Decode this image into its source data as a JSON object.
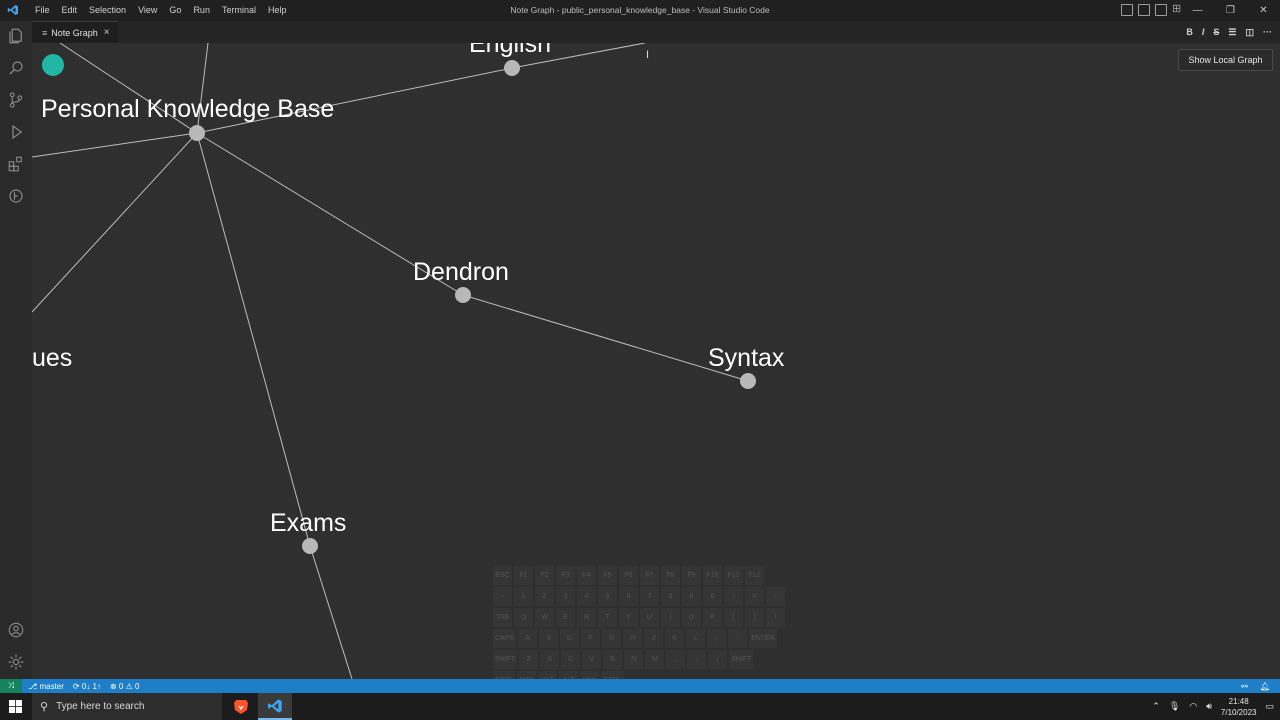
{
  "window": {
    "title": "Note Graph - public_personal_knowledge_base - Visual Studio Code",
    "menu": [
      "File",
      "Edit",
      "Selection",
      "View",
      "Go",
      "Run",
      "Terminal",
      "Help"
    ]
  },
  "tab": {
    "label": "Note Graph",
    "close": "×"
  },
  "editor_actions": [
    "B",
    "I",
    "S",
    "list-icon",
    "split-icon",
    "more-icon"
  ],
  "graph": {
    "show_local_button": "Show Local Graph",
    "nodes": [
      {
        "id": "english",
        "label": "English"
      },
      {
        "id": "pkb",
        "label": "Personal Knowledge Base"
      },
      {
        "id": "dendron",
        "label": "Dendron"
      },
      {
        "id": "syntax",
        "label": "Syntax"
      },
      {
        "id": "ues",
        "label": "ues"
      },
      {
        "id": "exams",
        "label": "Exams"
      }
    ],
    "edges": [
      [
        "pkb",
        "english"
      ],
      [
        "pkb",
        "dendron"
      ],
      [
        "dendron",
        "syntax"
      ],
      [
        "pkb",
        "exams"
      ]
    ]
  },
  "keyboard": {
    "rows": [
      [
        "ESC",
        "F1",
        "F2",
        "F3",
        "F4",
        "F5",
        "F6",
        "F7",
        "F8",
        "F9",
        "F10",
        "F11",
        "F12"
      ],
      [
        "~",
        "1",
        "2",
        "3",
        "4",
        "5",
        "6",
        "7",
        "8",
        "9",
        "0",
        "-",
        "=",
        "←"
      ],
      [
        "TAB",
        "Q",
        "W",
        "E",
        "R",
        "T",
        "Y",
        "U",
        "I",
        "O",
        "P",
        "[",
        "]",
        "\\"
      ],
      [
        "CAPS",
        "A",
        "S",
        "D",
        "F",
        "G",
        "H",
        "J",
        "K",
        "L",
        ";",
        "'",
        "ENTER"
      ],
      [
        "SHIFT",
        "Z",
        "X",
        "C",
        "V",
        "B",
        "N",
        "M",
        ",",
        ".",
        "/",
        "SHIFT"
      ],
      [
        "CTRL",
        "WIN",
        "ALT",
        "ALT",
        "WIN",
        "CTRL"
      ]
    ]
  },
  "statusbar": {
    "branch": "master",
    "sync": "0↓ 1↑",
    "errors": "0",
    "warnings": "0"
  },
  "taskbar": {
    "search_placeholder": "Type here to search",
    "time": "21:48",
    "date": "7/10/2023"
  },
  "colors": {
    "accent": "#1e7ec8",
    "remote": "#16825d",
    "fab": "#21b5a4",
    "node": "#b8b8b8",
    "edge": "#bdbdbd"
  }
}
